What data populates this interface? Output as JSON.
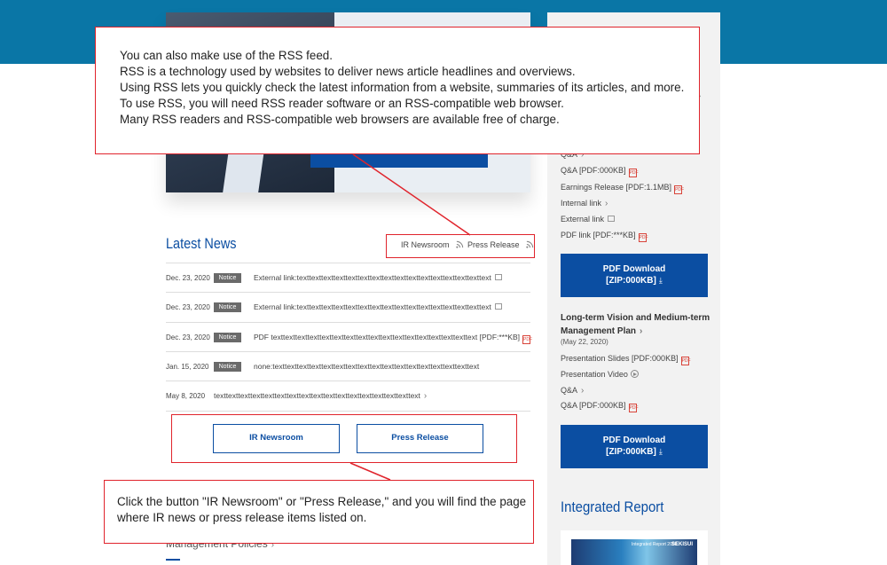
{
  "annotation_top": {
    "lines": [
      "You can also make use of the RSS feed.",
      "RSS is a technology used by websites to deliver news article headlines and overviews.",
      "Using RSS lets you quickly check the latest information from a website, summaries of its articles, and more.",
      "To use RSS, you will need RSS reader software or an RSS-compatible web browser.",
      "Many RSS readers and RSS-compatible web browsers are available free of charge."
    ]
  },
  "annotation_bottom": {
    "lines": [
      "Click the button \"IR Newsroom\" or \"Press Release,\" and you will find the page",
      "where IR news or press release items listed on."
    ]
  },
  "latest_news": {
    "title": "Latest News",
    "feeds": [
      "IR Newsroom",
      "Press Release"
    ],
    "items": [
      {
        "date": "Dec. 23, 2020",
        "badge": "Notice",
        "text": "External link:texttexttexttexttexttexttexttexttexttexttexttexttexttexttexttext"
      },
      {
        "date": "Dec. 23, 2020",
        "badge": "Notice",
        "text": "External link:texttexttexttexttexttexttexttexttexttexttexttexttexttexttexttext"
      },
      {
        "date": "Dec. 23, 2020",
        "badge": "Notice",
        "text": "PDF texttexttexttexttexttexttexttexttexttexttexttexttexttexttexttexttext",
        "suffix": "[PDF:***KB]"
      },
      {
        "date": "Jan. 15, 2020",
        "badge": "Notice",
        "text": "none:texttexttexttexttexttexttexttexttexttexttexttexttexttexttexttexttext"
      },
      {
        "date": "May 8, 2020",
        "badge": "",
        "text": "texttexttexttexttexttexttexttexttexttexttexttexttexttexttexttexttext"
      }
    ],
    "buttons": [
      "IR Newsroom",
      "Press Release"
    ]
  },
  "sidebar": {
    "block1": [
      {
        "label": "Q&A",
        "kind": "chevron"
      },
      {
        "label": "Q&A  [PDF:000KB]",
        "kind": "pdf"
      },
      {
        "label": "Earnings Release  [PDF:1.1MB]",
        "kind": "pdf"
      },
      {
        "label": "Internal link",
        "kind": "chevron"
      },
      {
        "label": "External link",
        "kind": "external"
      },
      {
        "label": "PDF link  [PDF:***KB]",
        "kind": "pdf"
      }
    ],
    "download1": {
      "line1": "PDF Download",
      "line2": "[ZIP:000KB]"
    },
    "plan_title": "Long-term Vision and Medium-term Management Plan",
    "plan_date": "(May 22, 2020)",
    "block2": [
      {
        "label": "Presentation Slides  [PDF:000KB]",
        "kind": "pdf"
      },
      {
        "label": "Presentation Video",
        "kind": "video"
      },
      {
        "label": "Q&A",
        "kind": "chevron"
      },
      {
        "label": "Q&A  [PDF:000KB]",
        "kind": "pdf"
      }
    ],
    "download2": {
      "line1": "PDF Download",
      "line2": "[ZIP:000KB]"
    },
    "integrated_title": "Integrated Report",
    "report_cover_text": "Integrated Report 2020",
    "report_cover_logo": "SEKISUI"
  },
  "footer_section": {
    "label": "Management Policies"
  },
  "icons": {
    "pdf": "pdf-icon",
    "external": "external-link-icon",
    "rss": "rss-icon",
    "download": "download-icon"
  },
  "colors": {
    "brand_blue": "#0b4ea2",
    "header_teal": "#0a76a6",
    "annotation_red": "#e0242c"
  }
}
